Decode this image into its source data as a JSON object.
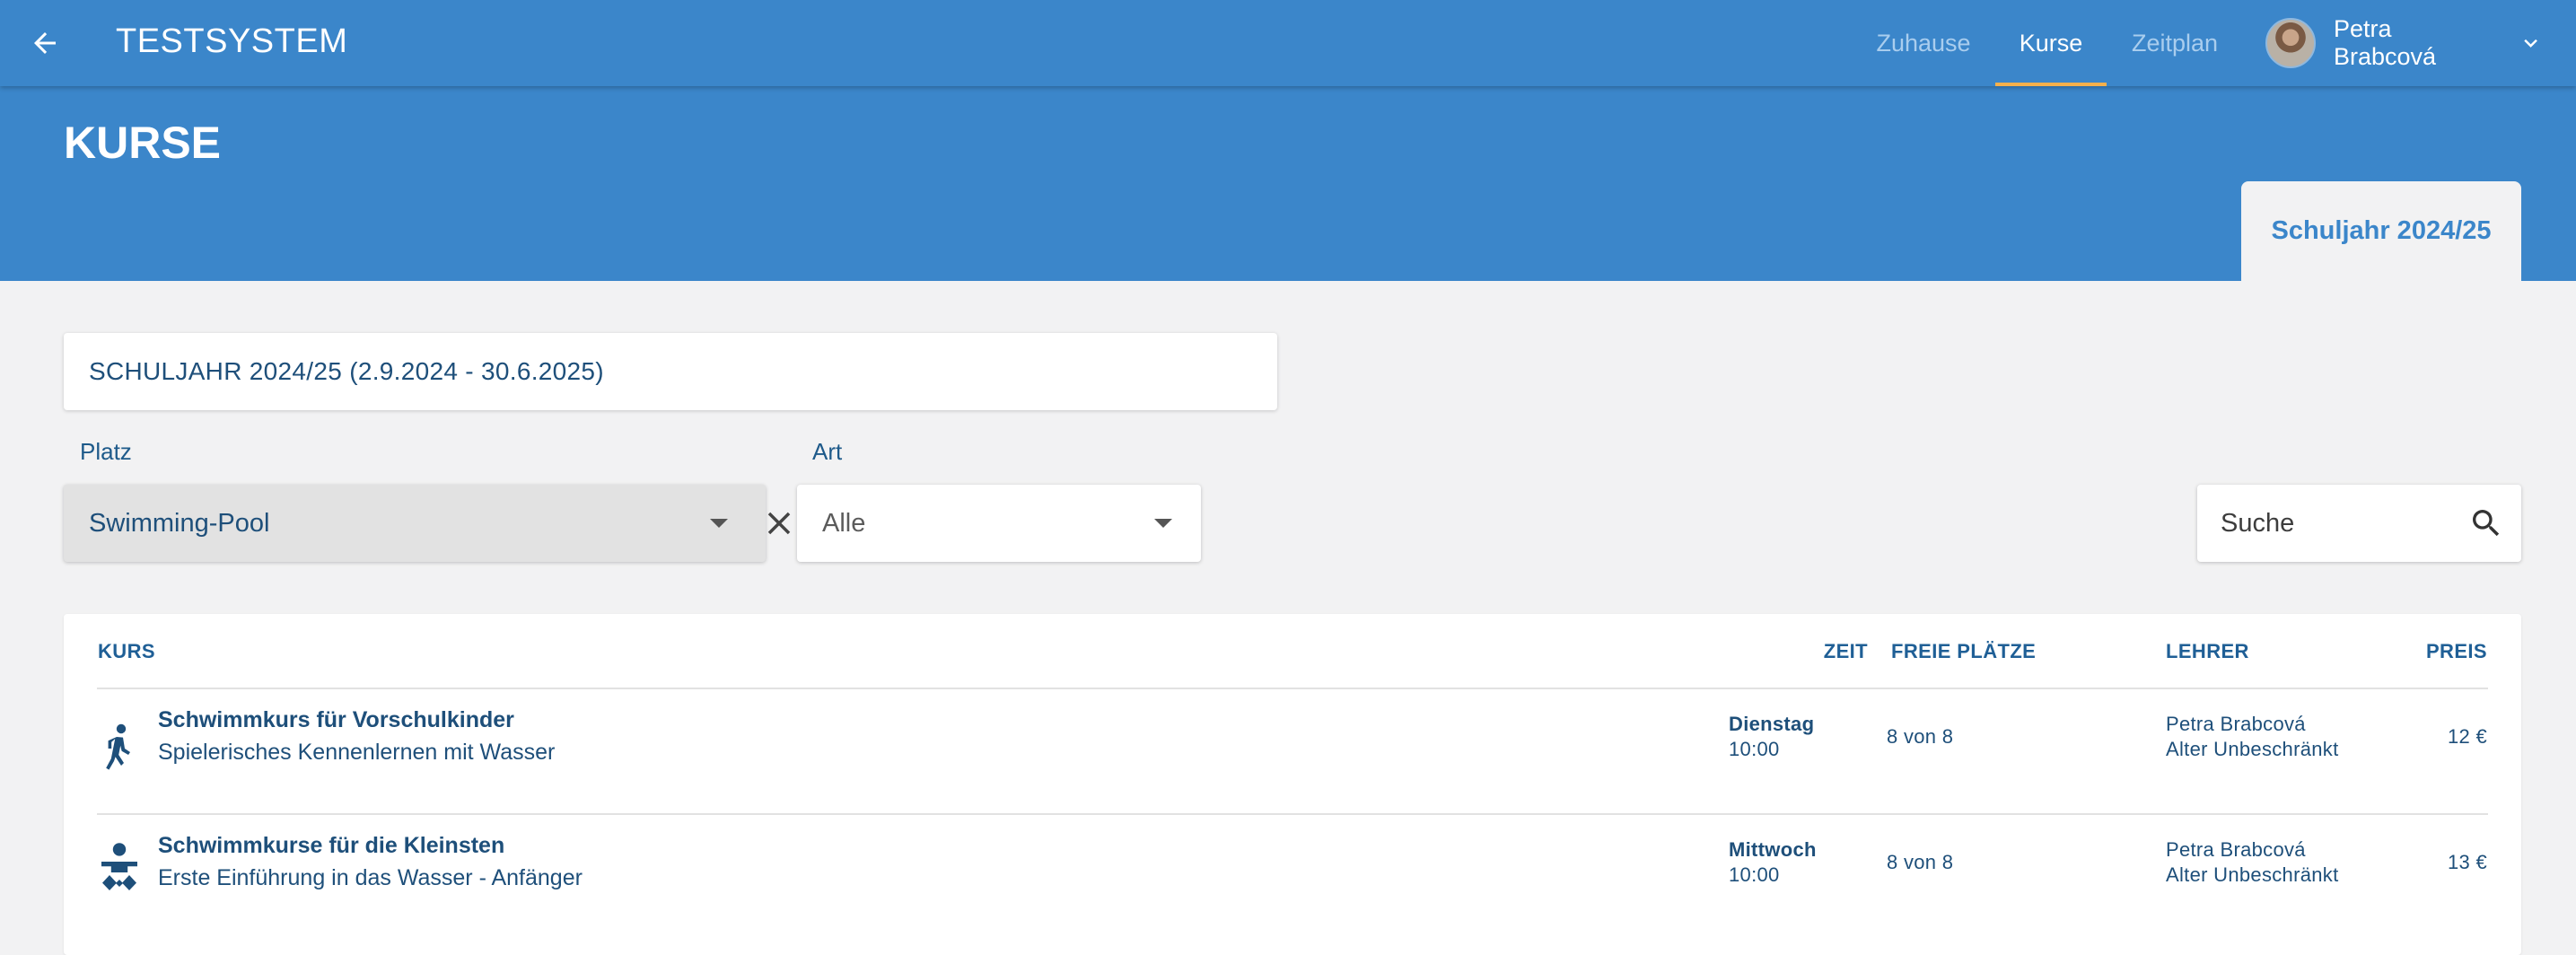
{
  "appbar": {
    "title": "TESTSYSTEM",
    "nav": [
      {
        "label": "Zuhause",
        "active": false
      },
      {
        "label": "Kurse",
        "active": true
      },
      {
        "label": "Zeitplan",
        "active": false
      }
    ],
    "user_name": "Petra Brabcová",
    "icons": {
      "back": "arrow-left-icon",
      "menu": "chevron-down-icon"
    }
  },
  "header": {
    "title": "KURSE",
    "year_tab": "Schuljahr 2024/25"
  },
  "filters": {
    "period": "SCHULJAHR 2024/25 (2.9.2024 - 30.6.2025)",
    "place_label": "Platz",
    "place_value": "Swimming-Pool",
    "type_label": "Art",
    "type_value": "Alle",
    "search_placeholder": "Suche"
  },
  "table": {
    "headers": {
      "course": "KURS",
      "time": "ZEIT",
      "free": "FREIE PLÄTZE",
      "teacher": "LEHRER",
      "price": "PREIS"
    },
    "rows": [
      {
        "icon": "walking-person-icon",
        "name": "Schwimmkurs für Vorschulkinder",
        "desc": "Spielerisches Kennenlernen mit Wasser",
        "day": "Dienstag",
        "time": "10:00",
        "free": "8 von 8",
        "teacher": "Petra Brabcová",
        "age": "Alter Unbeschränkt",
        "price": "12 €"
      },
      {
        "icon": "baby-icon",
        "name": "Schwimmkurse für die Kleinsten",
        "desc": "Erste Einführung in das Wasser - Anfänger",
        "day": "Mittwoch",
        "time": "10:00",
        "free": "8 von 8",
        "teacher": "Petra Brabcová",
        "age": "Alter Unbeschränkt",
        "price": "13 €"
      }
    ]
  },
  "colors": {
    "primary": "#3b86ca",
    "accent": "#f5b04c",
    "text": "#1e4f7a",
    "background": "#f2f2f3"
  }
}
